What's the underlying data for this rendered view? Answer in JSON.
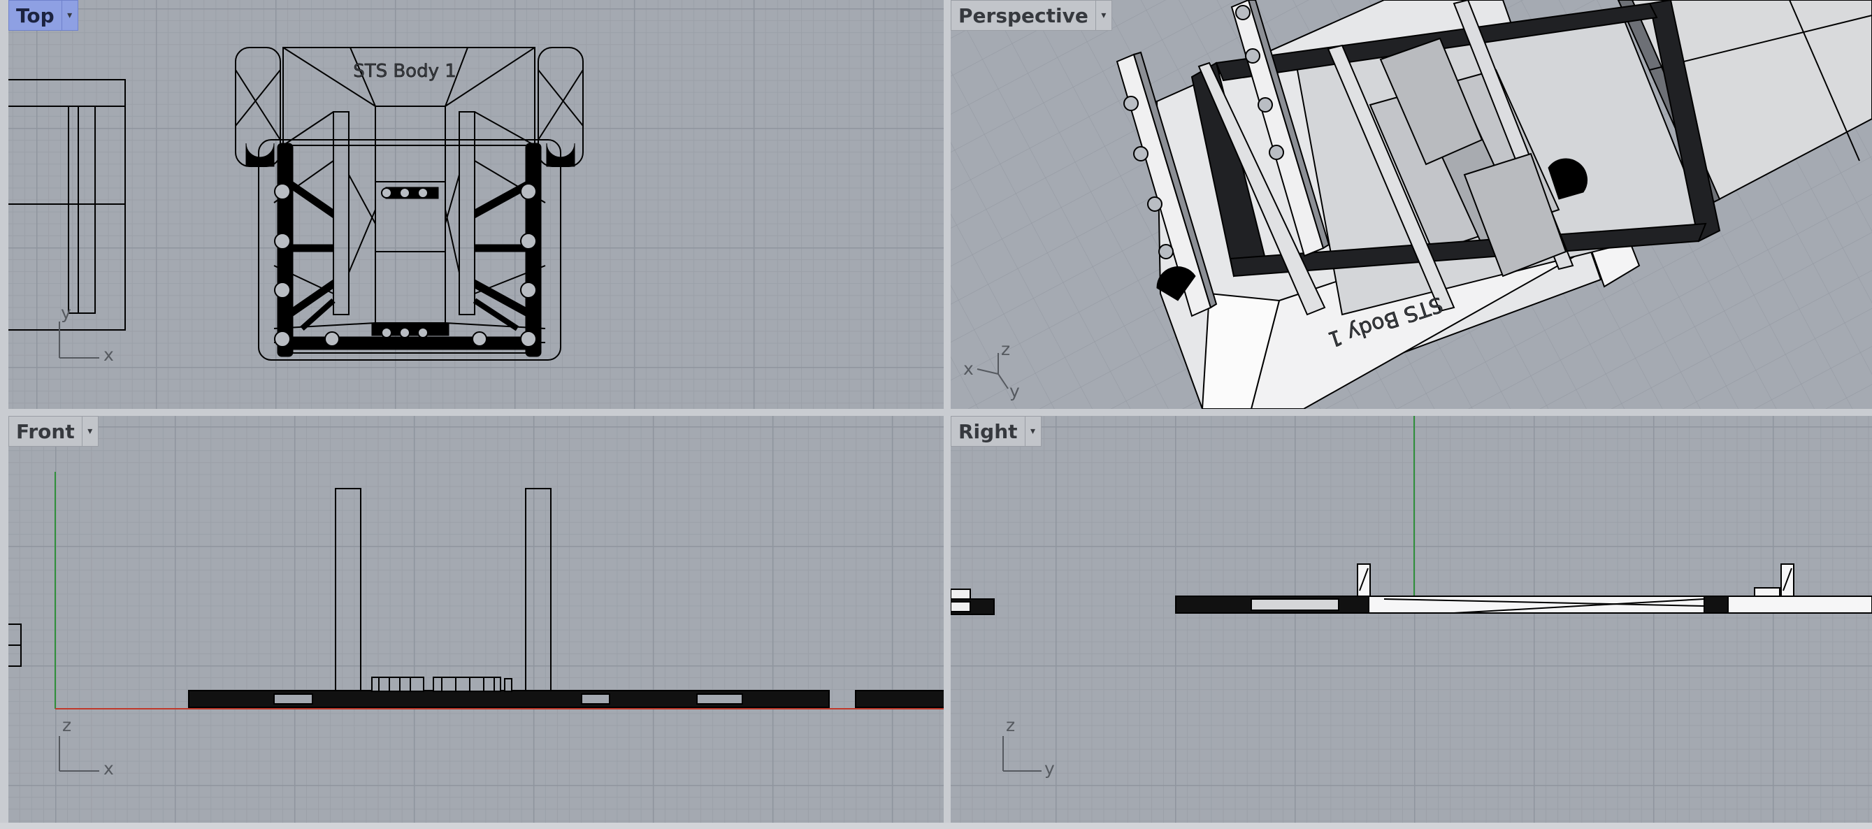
{
  "viewports": {
    "top": {
      "title": "Top",
      "active": true,
      "axes": [
        "y",
        "x"
      ]
    },
    "perspective": {
      "title": "Perspective",
      "active": false,
      "axes": [
        "z",
        "x",
        "y"
      ]
    },
    "front": {
      "title": "Front",
      "active": false,
      "axes": [
        "z",
        "x"
      ]
    },
    "right": {
      "title": "Right",
      "active": false,
      "axes": [
        "z",
        "y"
      ]
    }
  },
  "model": {
    "label": "STS Body 1"
  },
  "icons": {
    "viewport_menu": "chevron-down-icon"
  },
  "colors": {
    "viewport_bg": "#a4a9b1",
    "grid_major": "#8f959e",
    "grid_minor": "#9ba0a8",
    "active_tab": "#8ea0e3",
    "x_axis": "#c0392b",
    "y_axis": "#2f8f3a",
    "wire": "#000000"
  }
}
